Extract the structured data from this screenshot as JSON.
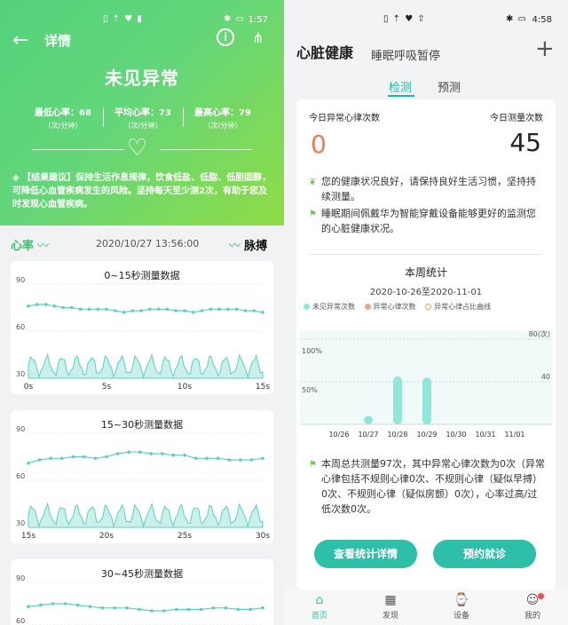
{
  "left": {
    "status_bar": {
      "time": "1:57",
      "icons": "▯ ⇡ ♥ ▮",
      "right_icons": "✱ ▭"
    },
    "header": {
      "back_icon": "arrow-left-icon",
      "title": "详情",
      "info_icon": "info-icon",
      "share_icon": "share-icon"
    },
    "result": "未见异常",
    "stats": [
      {
        "label": "最低心率：68",
        "unit": "（次/分钟）"
      },
      {
        "label": "平均心率：73",
        "unit": "（次/分钟）"
      },
      {
        "label": "最高心率：79",
        "unit": "（次/分钟）"
      }
    ],
    "advice": "【结果建议】保持生活作息规律，饮食低盐、低脂、低胆固醇，可降低心血管疾病发生的风险。坚持每天至少测2次，有助于您及时发现心血管疾病。",
    "heart_rate_label": "心率",
    "datetime": "2020/10/27 13:56:00",
    "pulse_label": "脉搏",
    "cards": [
      {
        "title": "0~15秒测量数据",
        "y_ticks": [
          "90",
          "60",
          "30"
        ],
        "x_ticks": [
          "0s",
          "5s",
          "10s",
          "15s"
        ]
      },
      {
        "title": "15~30秒测量数据",
        "y_ticks": [
          "90",
          "60",
          "30"
        ],
        "x_ticks": [
          "15s",
          "20s",
          "25s",
          "30s"
        ]
      },
      {
        "title": "30~45秒测量数据",
        "y_ticks": [
          "90",
          "60"
        ],
        "x_ticks": []
      }
    ]
  },
  "right": {
    "status_bar": {
      "time": "4:58",
      "icons": "▯ ⇡ ♥ ⇧",
      "right_icons": "✱ ▭"
    },
    "title": "心脏健康",
    "subtitle": "睡眠呼吸暂停",
    "plus_icon": "plus-icon",
    "tabs": [
      "检测",
      "预测"
    ],
    "today_abnormal_label": "今日异常心律次数",
    "today_abnormal_value": "0",
    "today_total_label": "今日测量次数",
    "today_total_value": "45",
    "msg1": "您的健康状况良好，请保持良好生活习惯，坚持持续测量。",
    "msg2": "睡眠期间佩戴华为智能穿戴设备能够更好的监测您的心脏健康状况。",
    "week_title": "本周统计",
    "week_range": "2020-10-26至2020-11-01",
    "legend": [
      "未见异常次数",
      "异常心律次数",
      "异常心律占比曲线"
    ],
    "summary": "本周总共测量97次，其中异常心律次数为0次（异常心律包括不规则心律0次、不规则心律（疑似早搏）0次、不规则心律（疑似房颤）0次），心率过高/过低次数0次。",
    "btn_stats": "查看统计详情",
    "btn_appt": "预约就诊",
    "nav": [
      {
        "label": "首页",
        "icon": "home-icon"
      },
      {
        "label": "发现",
        "icon": "discover-icon"
      },
      {
        "label": "设备",
        "icon": "watch-icon"
      },
      {
        "label": "我的",
        "icon": "profile-icon"
      }
    ]
  },
  "colors": {
    "accent": "#2dbfa8",
    "green": "#5fd47a",
    "wave": "#5ccfc3",
    "bar": "#8fe6d9",
    "abnormal": "#f07b5a"
  },
  "chart_data": [
    {
      "type": "line",
      "title": "0~15秒测量数据",
      "series": [
        {
          "values": [
            76,
            77,
            77,
            76,
            75,
            75,
            74,
            74,
            74,
            74,
            73,
            72,
            73,
            73,
            74,
            74,
            74,
            73,
            73,
            72,
            73,
            74,
            74,
            74,
            74,
            73,
            73,
            72
          ]
        }
      ],
      "x": [
        "0s",
        "5s",
        "10s",
        "15s"
      ],
      "ylim": [
        30,
        90
      ]
    },
    {
      "type": "line",
      "title": "15~30秒测量数据",
      "series": [
        {
          "values": [
            71,
            73,
            74,
            74,
            75,
            75,
            74,
            75,
            77,
            78,
            78,
            77,
            77,
            76,
            76,
            74,
            74,
            74,
            73,
            73,
            73,
            74
          ]
        }
      ],
      "x": [
        "15s",
        "20s",
        "25s",
        "30s"
      ],
      "ylim": [
        30,
        90
      ]
    },
    {
      "type": "line",
      "title": "30~45秒测量数据",
      "series": [
        {
          "values": [
            73,
            74,
            75,
            75,
            74,
            73,
            72,
            72,
            72,
            71,
            70,
            70,
            71,
            71,
            71,
            72,
            72,
            71,
            71,
            72
          ]
        }
      ],
      "ylim": [
        60,
        90
      ]
    },
    {
      "type": "bar",
      "title": "本周统计",
      "categories": [
        "10/26",
        "10/27",
        "10/28",
        "10/29",
        "10/30",
        "10/31",
        "11/01"
      ],
      "series": [
        {
          "name": "未见异常次数",
          "values": [
            0,
            8,
            45,
            44,
            0,
            0,
            0
          ]
        },
        {
          "name": "异常心律次数",
          "values": [
            0,
            0,
            0,
            0,
            0,
            0,
            0
          ]
        }
      ],
      "y_left_ticks": [
        "100%",
        "50%"
      ],
      "y_right_ticks": [
        "80(次)",
        "40"
      ],
      "ylim": [
        0,
        80
      ]
    }
  ]
}
